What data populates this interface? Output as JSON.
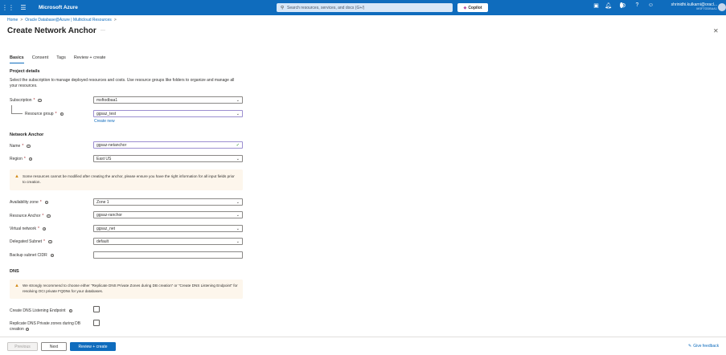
{
  "topbar": {
    "brand": "Microsoft Azure",
    "search_placeholder": "Search resources, services, and docs (G+/)",
    "copilot": "Copilot",
    "notification_count": "1",
    "user_name": "shrinidhi.kulkarni@oracl...",
    "user_tenant": "MSFTODBAA1"
  },
  "breadcrumb": {
    "home": "Home",
    "sep": ">",
    "parent": "Oracle Database@Azure | Multicloud Resources"
  },
  "page": {
    "title": "Create Network Anchor"
  },
  "tabs": [
    "Basics",
    "Consent",
    "Tags",
    "Review + create"
  ],
  "project": {
    "heading": "Project details",
    "description": "Select the subscription to manage deployed resources and costs. Use resource groups like folders to organize and manage all your resources.",
    "subscription_label": "Subscription",
    "subscription_value": "msftodbaa1",
    "resource_group_label": "Resource group",
    "resource_group_value": "ggsaz_test",
    "create_new": "Create new"
  },
  "anchor": {
    "heading": "Network Anchor",
    "name_label": "Name",
    "name_value": "ggsaz-netanchor",
    "region_label": "Region",
    "region_value": "East US",
    "warning": "Some resources cannot be modified after creating the anchor, please ensure you have the right information for all input fields prior to creation.",
    "az_label": "Availability zone",
    "az_value": "Zone 1",
    "ranchor_label": "Resource Anchor",
    "ranchor_value": "ggsaz-ranchor",
    "vnet_label": "Virtual network",
    "vnet_value": "ggsaz_net",
    "subnet_label": "Delegated Subnet",
    "subnet_value": "default",
    "backup_label": "Backup subnet CIDR",
    "backup_value": ""
  },
  "dns": {
    "heading": "DNS",
    "warning": "We strongly recommend to choose either \"Replicate DNS Private Zones during DB creation\" or \"Create DNS Listening Endpoint\" for resolving OCI private FQDNs for your databases.",
    "listening_label": "Create DNS Listening Endpoint",
    "replicate_label_1": "Replicate DNS Private zones during DB",
    "replicate_label_2": "creation"
  },
  "footer": {
    "previous": "Previous",
    "next": "Next",
    "review": "Review + create",
    "feedback": "Give feedback"
  },
  "colors": {
    "accent": "#0f6cbd",
    "warning": "#d38b19"
  }
}
